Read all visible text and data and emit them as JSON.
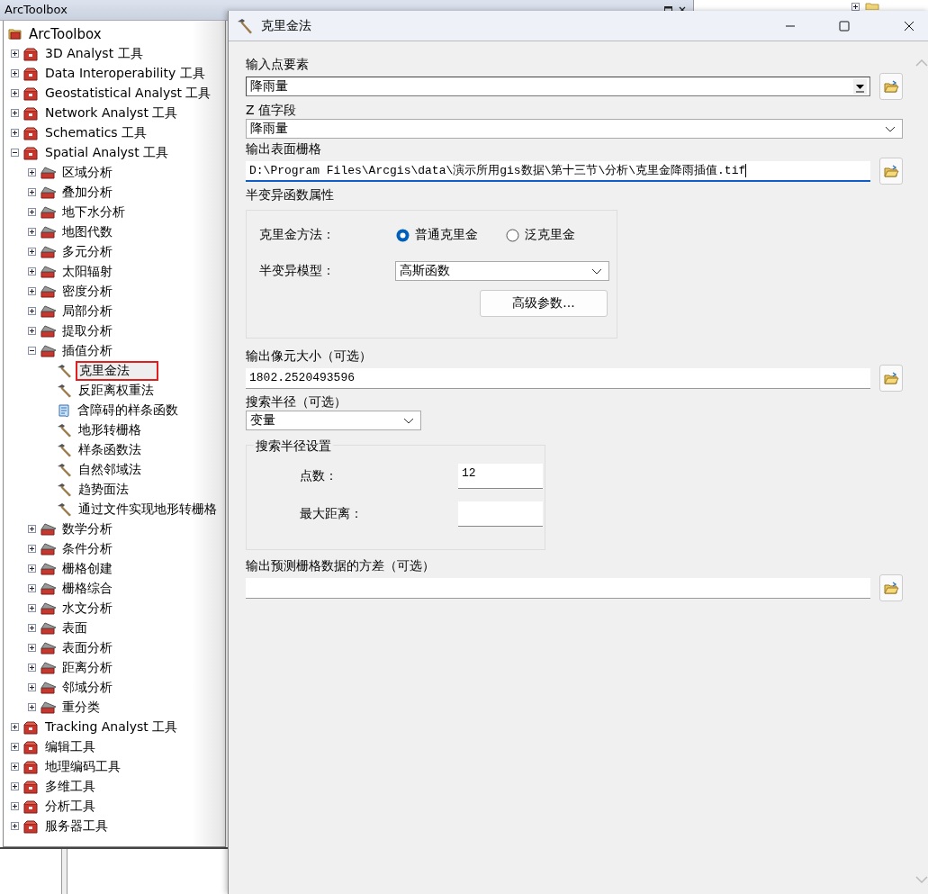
{
  "toolbox_panel": {
    "title": "ArcToolbox",
    "tree": [
      {
        "label": "ArcToolbox",
        "kind": "root",
        "children": [
          {
            "label": "3D Analyst 工具",
            "kind": "toolbox",
            "expanded": false
          },
          {
            "label": "Data Interoperability 工具",
            "kind": "toolbox",
            "expanded": false
          },
          {
            "label": "Geostatistical Analyst 工具",
            "kind": "toolbox",
            "expanded": false
          },
          {
            "label": "Network Analyst 工具",
            "kind": "toolbox",
            "expanded": false
          },
          {
            "label": "Schematics 工具",
            "kind": "toolbox",
            "expanded": false
          },
          {
            "label": "Spatial Analyst 工具",
            "kind": "toolbox",
            "expanded": true,
            "children": [
              {
                "label": "区域分析",
                "kind": "toolset",
                "expanded": false
              },
              {
                "label": "叠加分析",
                "kind": "toolset",
                "expanded": false
              },
              {
                "label": "地下水分析",
                "kind": "toolset",
                "expanded": false
              },
              {
                "label": "地图代数",
                "kind": "toolset",
                "expanded": false
              },
              {
                "label": "多元分析",
                "kind": "toolset",
                "expanded": false
              },
              {
                "label": "太阳辐射",
                "kind": "toolset",
                "expanded": false
              },
              {
                "label": "密度分析",
                "kind": "toolset",
                "expanded": false
              },
              {
                "label": "局部分析",
                "kind": "toolset",
                "expanded": false
              },
              {
                "label": "提取分析",
                "kind": "toolset",
                "expanded": false
              },
              {
                "label": "插值分析",
                "kind": "toolset",
                "expanded": true,
                "children": [
                  {
                    "label": "克里金法",
                    "kind": "tool",
                    "selected": true
                  },
                  {
                    "label": "反距离权重法",
                    "kind": "tool",
                    "selected": false
                  },
                  {
                    "label": "含障碍的样条函数",
                    "kind": "script",
                    "selected": false
                  },
                  {
                    "label": "地形转栅格",
                    "kind": "tool",
                    "selected": false
                  },
                  {
                    "label": "样条函数法",
                    "kind": "tool",
                    "selected": false
                  },
                  {
                    "label": "自然邻域法",
                    "kind": "tool",
                    "selected": false
                  },
                  {
                    "label": "趋势面法",
                    "kind": "tool",
                    "selected": false
                  },
                  {
                    "label": "通过文件实现地形转栅格",
                    "kind": "tool",
                    "selected": false
                  }
                ]
              },
              {
                "label": "数学分析",
                "kind": "toolset",
                "expanded": false
              },
              {
                "label": "条件分析",
                "kind": "toolset",
                "expanded": false
              },
              {
                "label": "栅格创建",
                "kind": "toolset",
                "expanded": false
              },
              {
                "label": "栅格综合",
                "kind": "toolset",
                "expanded": false
              },
              {
                "label": "水文分析",
                "kind": "toolset",
                "expanded": false
              },
              {
                "label": "表面",
                "kind": "toolset",
                "expanded": false
              },
              {
                "label": "表面分析",
                "kind": "toolset",
                "expanded": false
              },
              {
                "label": "距离分析",
                "kind": "toolset",
                "expanded": false
              },
              {
                "label": "邻域分析",
                "kind": "toolset",
                "expanded": false
              },
              {
                "label": "重分类",
                "kind": "toolset",
                "expanded": false
              }
            ]
          },
          {
            "label": "Tracking Analyst 工具",
            "kind": "toolbox",
            "expanded": false
          },
          {
            "label": "编辑工具",
            "kind": "toolbox",
            "expanded": false
          },
          {
            "label": "地理编码工具",
            "kind": "toolbox",
            "expanded": false
          },
          {
            "label": "多维工具",
            "kind": "toolbox",
            "expanded": false
          },
          {
            "label": "分析工具",
            "kind": "toolbox",
            "expanded": false
          },
          {
            "label": "服务器工具",
            "kind": "toolbox",
            "expanded": false
          }
        ]
      }
    ]
  },
  "dialog": {
    "title": "克里金法",
    "params": [
      {
        "kind": "combo_browse",
        "label": "输入点要素",
        "value": "降雨量"
      },
      {
        "kind": "select",
        "label": "Z 值字段",
        "value": "降雨量"
      },
      {
        "kind": "text_browse",
        "label": "输出表面栅格",
        "value": "D:\\Program Files\\Arcgis\\data\\演示所用gis数据\\第十三节\\分析\\克里金降雨插值.tif",
        "focused": true
      },
      {
        "kind": "kriging_group",
        "label": "半变异函数属性",
        "method_label": "克里金方法：",
        "methods": [
          {
            "label": "普通克里金",
            "selected": true
          },
          {
            "label": "泛克里金",
            "selected": false
          }
        ],
        "model_label": "半变异模型：",
        "model_value": "高斯函数",
        "button": "高级参数..."
      },
      {
        "kind": "text_browse",
        "label": "输出像元大小（可选）",
        "value": "1802.2520493596",
        "focused": false
      },
      {
        "kind": "short_select",
        "label": "搜索半径（可选）",
        "value": "变量"
      },
      {
        "kind": "fieldset",
        "legend": "搜索半径设置",
        "rows": [
          {
            "label": "点数：",
            "value": "12"
          },
          {
            "label": "最大距离："
          }
        ]
      },
      {
        "kind": "text_browse",
        "label": "输出预测栅格数据的方差（可选）",
        "focused": false
      }
    ]
  }
}
